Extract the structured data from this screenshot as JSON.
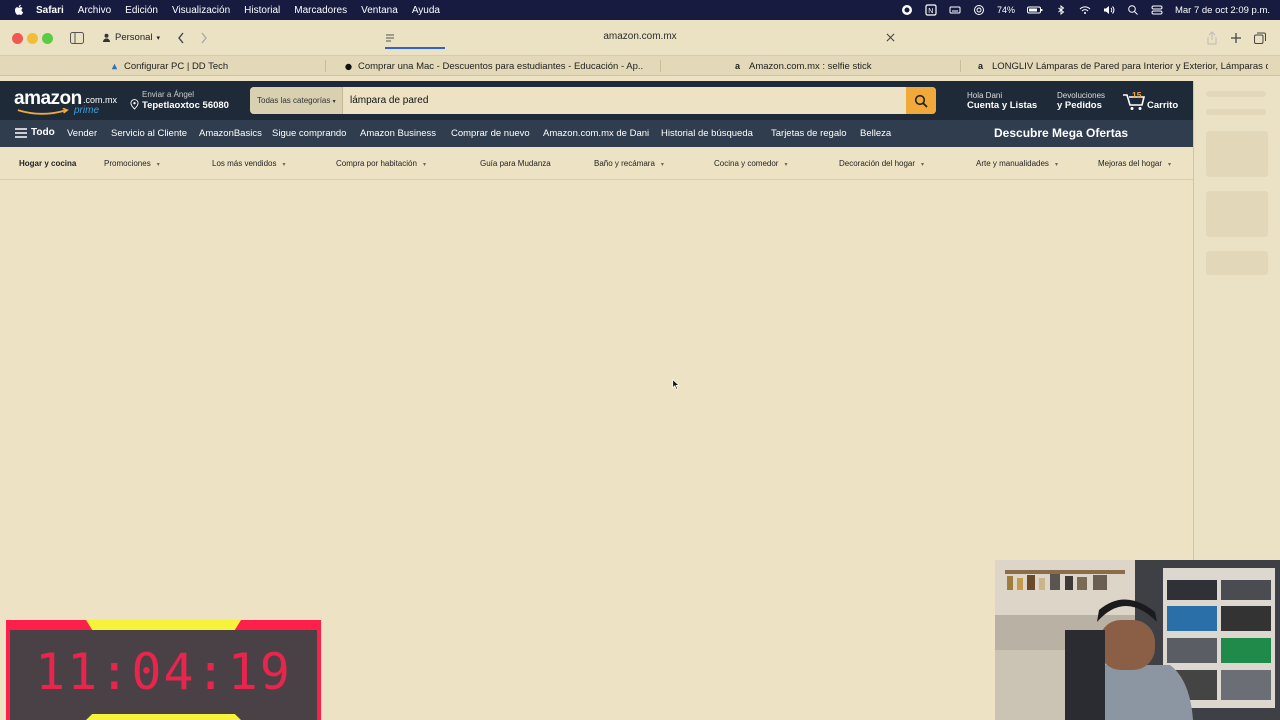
{
  "menubar": {
    "app": "Safari",
    "items": [
      "Archivo",
      "Edición",
      "Visualización",
      "Historial",
      "Marcadores",
      "Ventana",
      "Ayuda"
    ],
    "battery": "74%",
    "datetime": "Mar 7 de oct  2:09 p.m."
  },
  "toolbar": {
    "profile": "Personal",
    "url": "amazon.com.mx"
  },
  "tabs": [
    {
      "label": "Configurar PC | DD Tech"
    },
    {
      "label": "Comprar una Mac - Descuentos para estudiantes - Educación - Ap..."
    },
    {
      "label": "Amazon.com.mx : selfie stick"
    },
    {
      "label": "LONGLIV Lámparas de Pared para Interior y Exterior, Lámparas de..."
    }
  ],
  "amazon": {
    "logo": "amazon",
    "logo_suffix": ".com.mx",
    "logo_prime": "prime",
    "deliver_line1": "Enviar a Ángel",
    "deliver_line2": "Tepetlaoxtoc 56080",
    "search_category": "Todas las categorías",
    "search_value": "lámpara de pared",
    "account_line1": "Hola Dani",
    "account_line2": "Cuenta y Listas",
    "returns_line1": "Devoluciones",
    "returns_line2": "y Pedidos",
    "cart_count": "15",
    "cart_label": "Carrito",
    "nav_all": "Todo",
    "nav": [
      "Vender",
      "Servicio al Cliente",
      "AmazonBasics",
      "Sigue comprando",
      "Amazon Business",
      "Comprar de nuevo",
      "Amazon.com.mx de Dani",
      "Historial de búsqueda",
      "Tarjetas de regalo",
      "Belleza"
    ],
    "promo": "Descubre Mega Ofertas",
    "subnav": [
      "Hogar y cocina",
      "Promociones",
      "Los más vendidos",
      "Compra por habitación",
      "Guía para Mudanza",
      "Baño y recámara",
      "Cocina y comedor",
      "Decoración del hogar",
      "Arte y manualidades",
      "Mejoras del hogar"
    ]
  },
  "overlay": {
    "timer": "11:04:19"
  },
  "colors": {
    "menubar": "#171b40",
    "amazon_header": "#1f2a38",
    "amazon_nav": "#2f3d4f",
    "search_button": "#f2a93b",
    "timer_frame": "#ff1f4b",
    "timer_tab": "#f7f33a"
  }
}
